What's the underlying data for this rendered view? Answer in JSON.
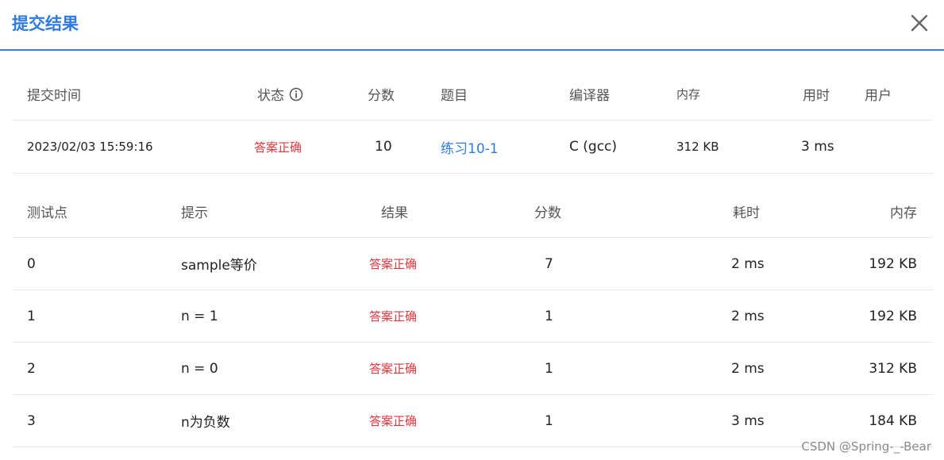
{
  "dialog": {
    "title": "提交结果",
    "close_icon": "close-icon"
  },
  "submission": {
    "headers": {
      "time": "提交时间",
      "status": "状态",
      "score": "分数",
      "problem": "题目",
      "compiler": "编译器",
      "memory": "内存",
      "duration": "用时",
      "user": "用户"
    },
    "row": {
      "time": "2023/02/03 15:59:16",
      "status": "答案正确",
      "score": "10",
      "problem": "练习10-1",
      "compiler": "C (gcc)",
      "memory": "312 KB",
      "duration": "3 ms",
      "user": ""
    }
  },
  "testcases": {
    "headers": {
      "id": "测试点",
      "hint": "提示",
      "result": "结果",
      "score": "分数",
      "time": "耗时",
      "memory": "内存"
    },
    "rows": [
      {
        "id": "0",
        "hint": "sample等价",
        "result": "答案正确",
        "score": "7",
        "time": "2 ms",
        "memory": "192 KB"
      },
      {
        "id": "1",
        "hint": "n = 1",
        "result": "答案正确",
        "score": "1",
        "time": "2 ms",
        "memory": "192 KB"
      },
      {
        "id": "2",
        "hint": "n = 0",
        "result": "答案正确",
        "score": "1",
        "time": "2 ms",
        "memory": "312 KB"
      },
      {
        "id": "3",
        "hint": "n为负数",
        "result": "答案正确",
        "score": "1",
        "time": "3 ms",
        "memory": "184 KB"
      }
    ]
  },
  "watermark": "CSDN @Spring-_-Bear",
  "colors": {
    "accent": "#2f7be0",
    "success": "#e0383e",
    "divider": "#e8e8e8"
  }
}
